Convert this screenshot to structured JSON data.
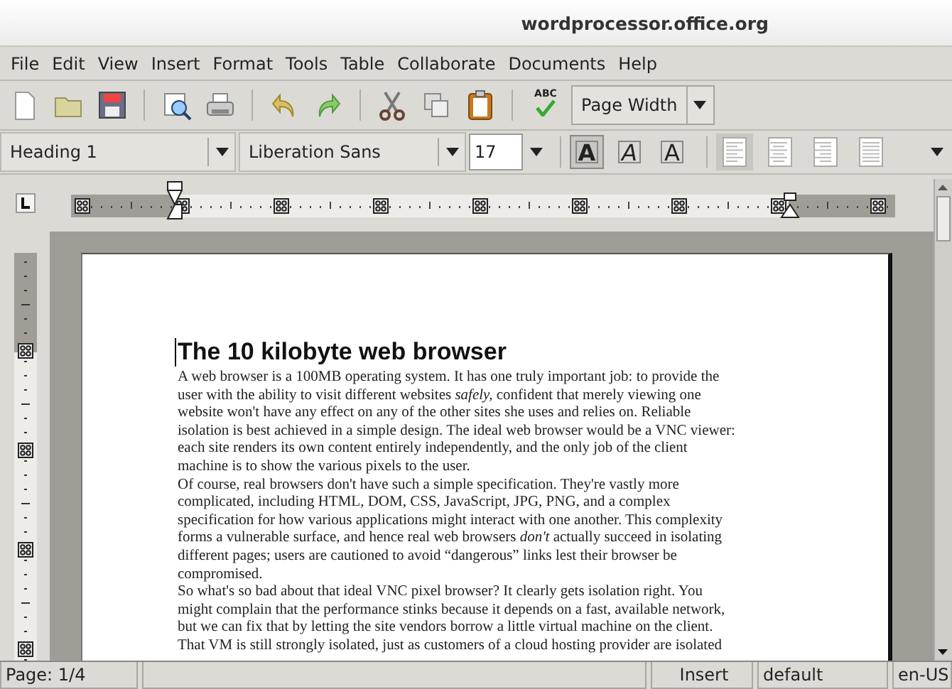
{
  "window": {
    "title": "wordprocessor.office.org"
  },
  "menu": [
    {
      "label": "File"
    },
    {
      "label": "Edit"
    },
    {
      "label": "View"
    },
    {
      "label": "Insert"
    },
    {
      "label": "Format"
    },
    {
      "label": "Tools"
    },
    {
      "label": "Table"
    },
    {
      "label": "Collaborate"
    },
    {
      "label": "Documents"
    },
    {
      "label": "Help"
    }
  ],
  "toolbar": {
    "spellcheck_label": "ABC",
    "zoom": "Page Width"
  },
  "format_bar": {
    "style": "Heading 1",
    "font": "Liberation Sans",
    "size": "17",
    "char_buttons": [
      {
        "kind": "bold",
        "label": "A",
        "on": true
      },
      {
        "kind": "italic",
        "label": "A",
        "on": false
      },
      {
        "kind": "underline",
        "label": "A",
        "on": false
      }
    ],
    "align_buttons": [
      {
        "kind": "left",
        "selected": true
      },
      {
        "kind": "center",
        "selected": false
      },
      {
        "kind": "right",
        "selected": false
      },
      {
        "kind": "justify",
        "selected": false
      }
    ]
  },
  "document": {
    "heading": "The 10 kilobyte web browser",
    "paragraphs": [
      [
        "A web browser is a 100MB operating system. It has one truly important job: to provide the",
        "user with the ability to visit different websites *safely,* confident that merely viewing one",
        "website won't have any effect on any of the other sites she uses and relies on. Reliable",
        "isolation is best achieved in a simple design. The ideal web browser would be a VNC viewer:",
        "each site renders its own content entirely independently, and the only job of the client",
        "machine is to show the various pixels to the user."
      ],
      [
        "Of course, real browsers don't have such a simple specification. They're vastly more",
        "complicated, including HTML, DOM, CSS, JavaScript, JPG, PNG, and a complex",
        "specification for how various applications might interact with one another. This complexity",
        "forms a vulnerable surface, and hence real web browsers *don't* actually succeed in isolating",
        "different pages; users are cautioned to avoid “dangerous” links lest their browser be",
        "compromised."
      ],
      [
        "So what's so bad about that ideal VNC pixel browser? It clearly gets isolation right. You",
        "might complain that the performance stinks because it depends on a fast, available network,",
        "but we can fix that by letting the site vendors borrow a little virtual machine on the client.",
        "That VM is still strongly isolated, just as customers of a cloud hosting provider are isolated"
      ]
    ]
  },
  "status_bar": {
    "page": "Page: 1/4",
    "mode": "Insert",
    "page_style": "default",
    "language": "en-US"
  }
}
